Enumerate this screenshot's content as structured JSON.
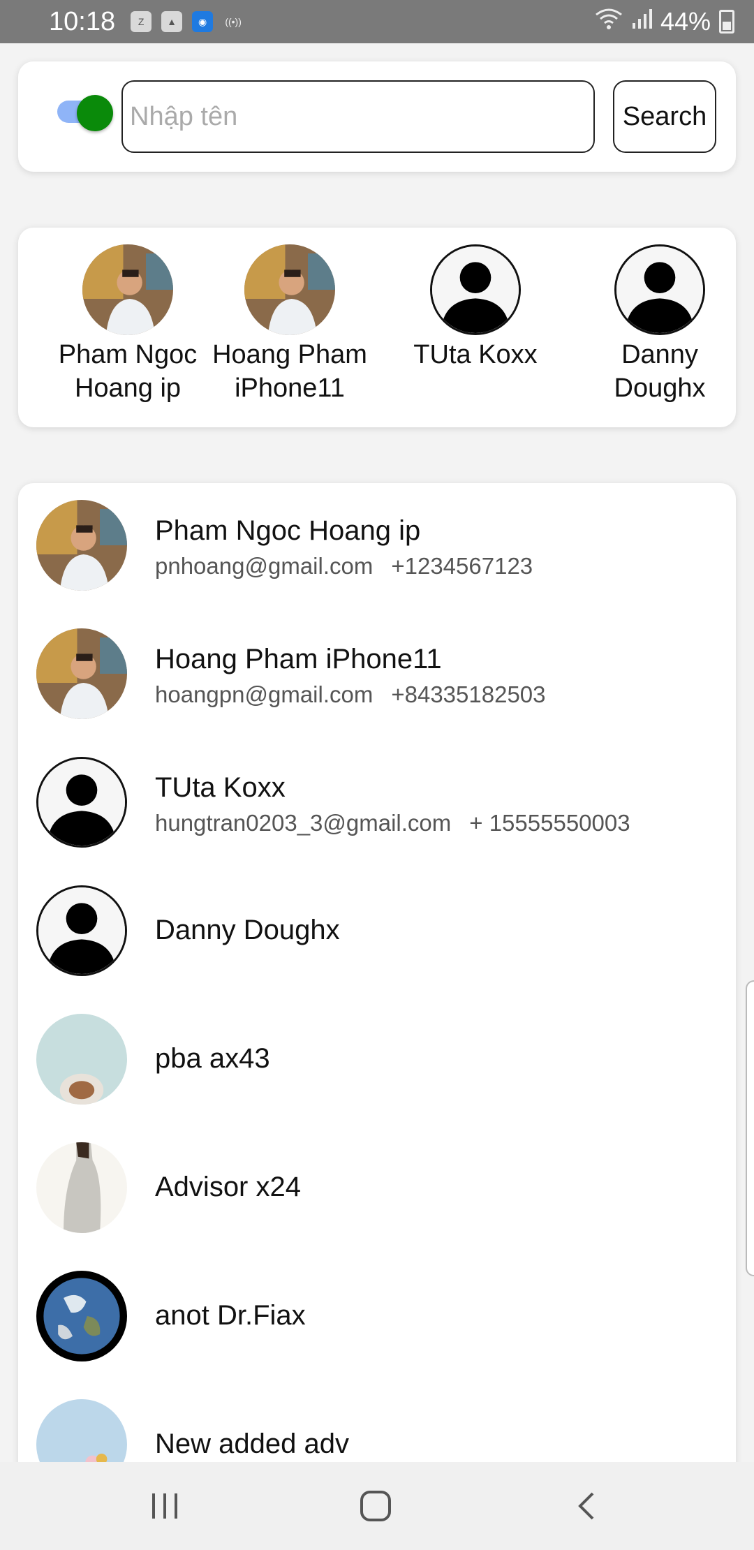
{
  "status_bar": {
    "time": "10:18",
    "notification_icons": [
      "zalo-icon",
      "gallery-icon",
      "hotspot-icon",
      "broadcast-icon"
    ],
    "battery": "44%"
  },
  "search": {
    "toggle_on": true,
    "placeholder": "Nhập tên",
    "value": "",
    "button_label": "Search"
  },
  "favorites": [
    {
      "line1": "Pham Ngoc",
      "line2": "Hoang ip",
      "avatar": "photo-man"
    },
    {
      "line1": "Hoang Pham",
      "line2": "iPhone11",
      "avatar": "photo-man"
    },
    {
      "line1": "TUta Koxx",
      "line2": "",
      "avatar": "placeholder-person"
    },
    {
      "line1": "Danny",
      "line2": "Doughx",
      "avatar": "placeholder-person"
    }
  ],
  "contacts": [
    {
      "name": "Pham Ngoc Hoang ip",
      "email": "pnhoang@gmail.com",
      "phone": "+1234567123",
      "avatar": "photo-man"
    },
    {
      "name": "Hoang Pham iPhone11",
      "email": "hoangpn@gmail.com",
      "phone": "+84335182503",
      "avatar": "photo-man"
    },
    {
      "name": "TUta Koxx",
      "email": "hungtran0203_3@gmail.com",
      "phone": "+ 15555550003",
      "avatar": "placeholder-person"
    },
    {
      "name": "Danny Doughx",
      "email": "",
      "phone": "",
      "avatar": "placeholder-person"
    },
    {
      "name": "pba ax43",
      "email": "",
      "phone": "",
      "avatar": "photo-coffee"
    },
    {
      "name": "Advisor x24",
      "email": "",
      "phone": "",
      "avatar": "photo-woman"
    },
    {
      "name": "anot Dr.Fiax",
      "email": "",
      "phone": "",
      "avatar": "photo-earth"
    },
    {
      "name": "New added adv",
      "email": "",
      "phone": "",
      "avatar": "photo-flowers"
    }
  ],
  "nav_bar": {
    "buttons": [
      "recents-icon",
      "home-icon",
      "back-icon"
    ]
  },
  "colors": {
    "toggle_knob": "#0a8a0a",
    "toggle_track": "#8fb4f7",
    "status_bar": "#7a7a7a"
  }
}
